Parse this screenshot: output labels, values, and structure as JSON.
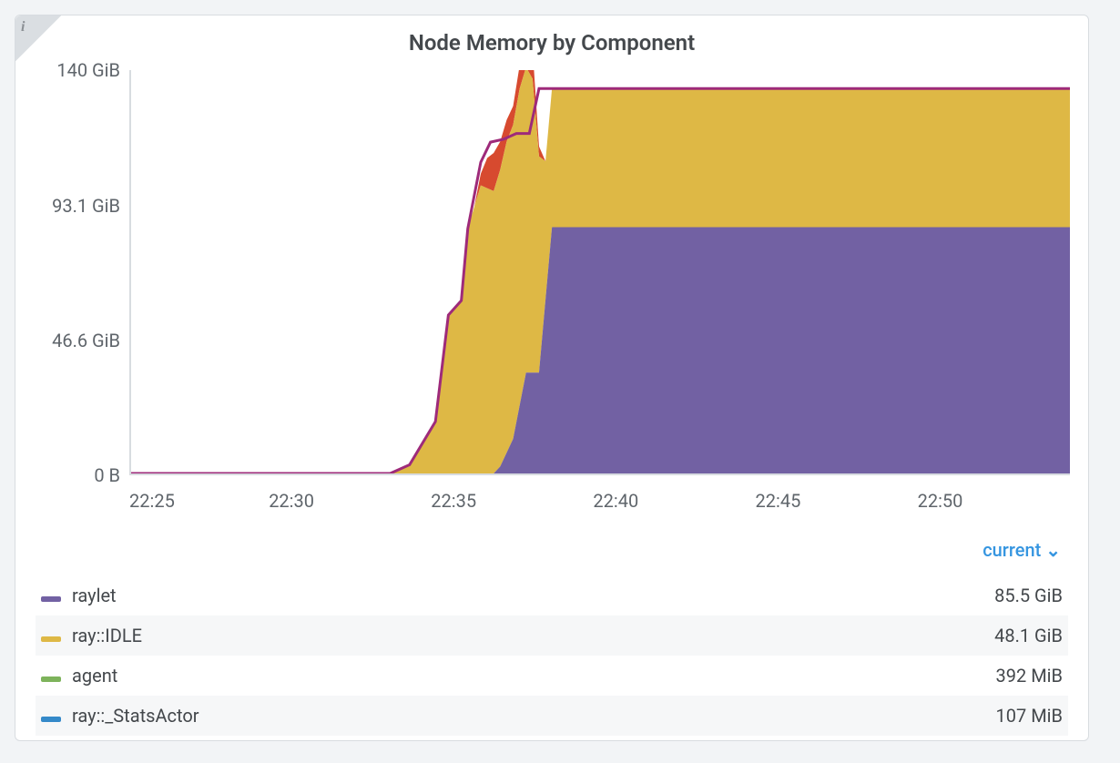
{
  "panel": {
    "title": "Node Memory by Component",
    "info_icon": "i"
  },
  "dropdown": {
    "label": "current",
    "chev": "⌄"
  },
  "y_ticks": [
    {
      "label": "140 GiB",
      "val": 140
    },
    {
      "label": "93.1 GiB",
      "val": 93.1
    },
    {
      "label": "46.6 GiB",
      "val": 46.6
    },
    {
      "label": "0 B",
      "val": 0
    }
  ],
  "x_ticks": [
    "22:25",
    "22:30",
    "22:35",
    "22:40",
    "22:45",
    "22:50"
  ],
  "legend": [
    {
      "name": "raylet",
      "color": "var(--c-raylet)",
      "value": "85.5 GiB"
    },
    {
      "name": "ray::IDLE",
      "color": "var(--c-idle)",
      "value": "48.1 GiB"
    },
    {
      "name": "agent",
      "color": "var(--c-agent)",
      "value": "392 MiB"
    },
    {
      "name": "ray::_StatsActor",
      "color": "var(--c-stats)",
      "value": "107 MiB"
    }
  ],
  "chart_data": {
    "type": "area",
    "title": "Node Memory by Component",
    "xlabel": "",
    "ylabel": "",
    "ylim": [
      0,
      140
    ],
    "xlim_minutes": [
      25,
      54
    ],
    "x_unit": "HH:MM starting at 22:00",
    "stacking": "stacked",
    "legend_position": "below",
    "series": [
      {
        "name": "raylet",
        "color": "#7261a3",
        "points": [
          {
            "t": 25,
            "v": 0
          },
          {
            "t": 33,
            "v": 0
          },
          {
            "t": 36.3,
            "v": 0
          },
          {
            "t": 36.8,
            "v": 12
          },
          {
            "t": 37.2,
            "v": 35
          },
          {
            "t": 37.6,
            "v": 35
          },
          {
            "t": 38.0,
            "v": 85.5
          },
          {
            "t": 54,
            "v": 85.5
          }
        ]
      },
      {
        "name": "ray::IDLE",
        "color": "#deb845",
        "points": [
          {
            "t": 25,
            "v": 0
          },
          {
            "t": 33,
            "v": 0
          },
          {
            "t": 33.6,
            "v": 3
          },
          {
            "t": 34.4,
            "v": 18
          },
          {
            "t": 34.8,
            "v": 55
          },
          {
            "t": 35.2,
            "v": 60
          },
          {
            "t": 35.4,
            "v": 85
          },
          {
            "t": 35.8,
            "v": 100
          },
          {
            "t": 36.2,
            "v": 98
          },
          {
            "t": 36.6,
            "v": 108
          },
          {
            "t": 37.0,
            "v": 110
          },
          {
            "t": 37.4,
            "v": 102
          },
          {
            "t": 37.8,
            "v": 48.1
          },
          {
            "t": 38.0,
            "v": 48.1
          },
          {
            "t": 54,
            "v": 48.1
          }
        ]
      },
      {
        "name": "red-transient",
        "color": "#d74a2f",
        "in_legend": false,
        "points": [
          {
            "t": 35.6,
            "v": 0
          },
          {
            "t": 35.9,
            "v": 6
          },
          {
            "t": 36.1,
            "v": 15
          },
          {
            "t": 36.5,
            "v": 8
          },
          {
            "t": 36.9,
            "v": 6
          },
          {
            "t": 37.3,
            "v": 14
          },
          {
            "t": 37.7,
            "v": 0
          }
        ]
      },
      {
        "name": "agent",
        "color": "#7db35b",
        "points": [
          {
            "t": 25,
            "v": 0.38
          },
          {
            "t": 54,
            "v": 0.38
          }
        ]
      },
      {
        "name": "ray::_StatsActor",
        "color": "#3489c9",
        "points": [
          {
            "t": 25,
            "v": 0.1
          },
          {
            "t": 54,
            "v": 0.1
          }
        ]
      }
    ],
    "total_line": {
      "color": "#9e2a7a",
      "points": [
        {
          "t": 25,
          "v": 0
        },
        {
          "t": 33,
          "v": 0
        },
        {
          "t": 33.6,
          "v": 3
        },
        {
          "t": 34.4,
          "v": 18
        },
        {
          "t": 34.8,
          "v": 55
        },
        {
          "t": 35.2,
          "v": 60
        },
        {
          "t": 35.4,
          "v": 85
        },
        {
          "t": 35.8,
          "v": 108
        },
        {
          "t": 36.1,
          "v": 115
        },
        {
          "t": 36.5,
          "v": 116
        },
        {
          "t": 36.9,
          "v": 118
        },
        {
          "t": 37.3,
          "v": 118
        },
        {
          "t": 37.6,
          "v": 133.6
        },
        {
          "t": 54,
          "v": 133.6
        }
      ]
    },
    "current_values": {
      "raylet": "85.5 GiB",
      "ray::IDLE": "48.1 GiB",
      "agent": "392 MiB",
      "ray::_StatsActor": "107 MiB"
    }
  }
}
